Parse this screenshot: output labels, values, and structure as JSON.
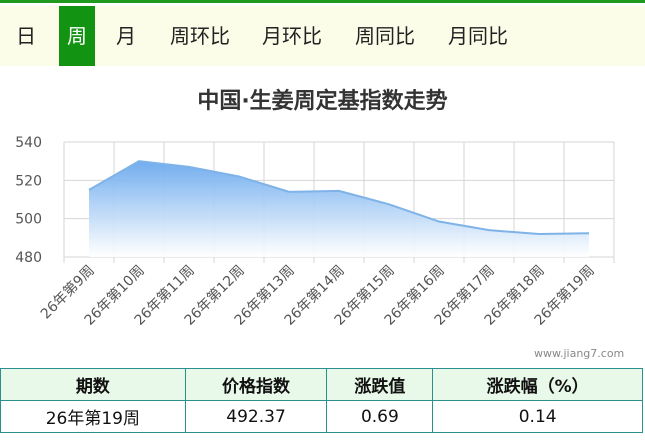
{
  "tabs": [
    {
      "label": "日",
      "active": false
    },
    {
      "label": "周",
      "active": true
    },
    {
      "label": "月",
      "active": false
    },
    {
      "label": "周环比",
      "active": false
    },
    {
      "label": "月环比",
      "active": false
    },
    {
      "label": "周同比",
      "active": false
    },
    {
      "label": "月同比",
      "active": false
    }
  ],
  "colors": {
    "active_tab": "#129412",
    "tab_bar_bg": "#fbfde9",
    "line": "#7fb3e8",
    "area_top": "#6aa9ee",
    "table_header_bg": "#e9f9e9",
    "table_border": "#2a8f8f"
  },
  "chart_data": {
    "type": "area",
    "title": "中国·生姜周定基指数走势",
    "xlabel": "",
    "ylabel": "",
    "categories": [
      "26年第9周",
      "26年第10周",
      "26年第11周",
      "26年第12周",
      "26年第13周",
      "26年第14周",
      "26年第15周",
      "26年第16周",
      "26年第17周",
      "26年第18周",
      "26年第19周"
    ],
    "series": [
      {
        "values": [
          515,
          530,
          527,
          522,
          514,
          514.5,
          507.5,
          498.5,
          494,
          492,
          492.37
        ]
      }
    ],
    "ylim": [
      480,
      540
    ],
    "yticks": [
      480,
      500,
      520,
      540
    ],
    "grid": true,
    "legend": "none"
  },
  "watermark": "www.jiang7.com",
  "table": {
    "headers": [
      "期数",
      "价格指数",
      "涨跌值",
      "涨跌幅（%）"
    ],
    "row": [
      "26年第19周",
      "492.37",
      "0.69",
      "0.14"
    ]
  }
}
